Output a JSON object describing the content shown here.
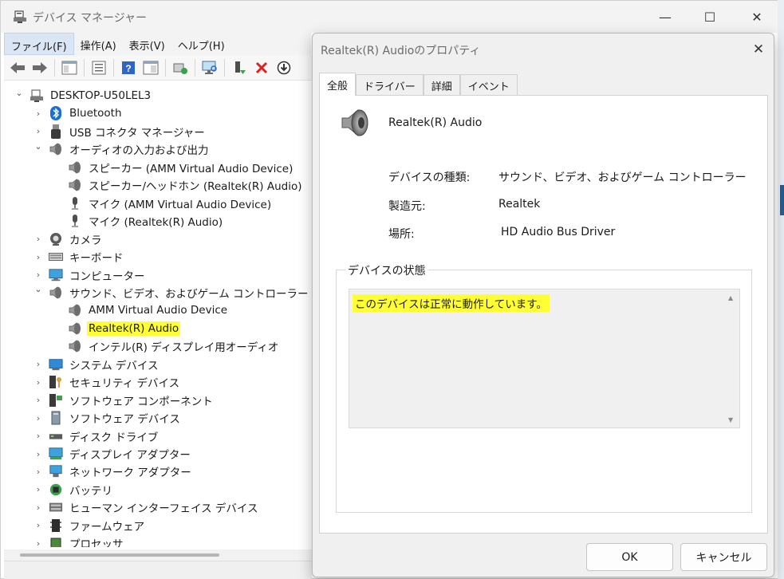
{
  "window": {
    "title": "デバイス マネージャー",
    "controls": {
      "minimize": "—",
      "maximize": "☐",
      "close": "✕"
    }
  },
  "menu": [
    "ファイル(F)",
    "操作(A)",
    "表示(V)",
    "ヘルプ(H)"
  ],
  "toolbar": [
    "back-arrow-icon",
    "forward-arrow-icon",
    "tree-view-icon",
    "properties-icon",
    "help-icon",
    "show-hidden-icon",
    "update-driver-icon",
    "scan-hardware-icon",
    "enable-device-icon",
    "uninstall-icon",
    "download-icon"
  ],
  "tree": [
    {
      "label": "DESKTOP-U50LEL3",
      "level": 0,
      "expanded": true,
      "icon": "computer-icon"
    },
    {
      "label": "Bluetooth",
      "level": 1,
      "expanded": false,
      "icon": "bluetooth-icon"
    },
    {
      "label": "USB コネクタ マネージャー",
      "level": 1,
      "expanded": false,
      "icon": "usb-icon"
    },
    {
      "label": "オーディオの入力および出力",
      "level": 1,
      "expanded": true,
      "icon": "speaker-icon"
    },
    {
      "label": "スピーカー (AMM Virtual Audio Device)",
      "level": 2,
      "icon": "speaker-icon"
    },
    {
      "label": "スピーカー/ヘッドホン (Realtek(R) Audio)",
      "level": 2,
      "icon": "speaker-icon"
    },
    {
      "label": "マイク (AMM Virtual Audio Device)",
      "level": 2,
      "icon": "microphone-icon"
    },
    {
      "label": "マイク (Realtek(R) Audio)",
      "level": 2,
      "icon": "microphone-icon"
    },
    {
      "label": "カメラ",
      "level": 1,
      "expanded": false,
      "icon": "camera-icon"
    },
    {
      "label": "キーボード",
      "level": 1,
      "expanded": false,
      "icon": "keyboard-icon"
    },
    {
      "label": "コンピューター",
      "level": 1,
      "expanded": false,
      "icon": "monitor-icon"
    },
    {
      "label": "サウンド、ビデオ、およびゲーム コントローラー",
      "level": 1,
      "expanded": true,
      "icon": "speaker-icon"
    },
    {
      "label": "AMM Virtual Audio Device",
      "level": 2,
      "icon": "speaker-icon"
    },
    {
      "label": "Realtek(R) Audio",
      "level": 2,
      "icon": "speaker-icon",
      "highlighted": true
    },
    {
      "label": "インテル(R) ディスプレイ用オーディオ",
      "level": 2,
      "icon": "speaker-icon"
    },
    {
      "label": "システム デバイス",
      "level": 1,
      "expanded": false,
      "icon": "system-folder-icon"
    },
    {
      "label": "セキュリティ デバイス",
      "level": 1,
      "expanded": false,
      "icon": "security-key-icon"
    },
    {
      "label": "ソフトウェア コンポーネント",
      "level": 1,
      "expanded": false,
      "icon": "software-component-icon"
    },
    {
      "label": "ソフトウェア デバイス",
      "level": 1,
      "expanded": false,
      "icon": "software-device-icon"
    },
    {
      "label": "ディスク ドライブ",
      "level": 1,
      "expanded": false,
      "icon": "disk-drive-icon"
    },
    {
      "label": "ディスプレイ アダプター",
      "level": 1,
      "expanded": false,
      "icon": "display-adapter-icon"
    },
    {
      "label": "ネットワーク アダプター",
      "level": 1,
      "expanded": false,
      "icon": "network-adapter-icon"
    },
    {
      "label": "バッテリ",
      "level": 1,
      "expanded": false,
      "icon": "battery-icon"
    },
    {
      "label": "ヒューマン インターフェイス デバイス",
      "level": 1,
      "expanded": false,
      "icon": "hid-icon"
    },
    {
      "label": "ファームウェア",
      "level": 1,
      "expanded": false,
      "icon": "firmware-icon"
    },
    {
      "label": "プロセッサ",
      "level": 1,
      "expanded": false,
      "icon": "processor-icon"
    }
  ],
  "dialog": {
    "title": "Realtek(R) Audioのプロパティ",
    "tabs": [
      "全般",
      "ドライバー",
      "詳細",
      "イベント"
    ],
    "active_tab": "全般",
    "device_name": "Realtek(R) Audio",
    "properties": [
      {
        "label": "デバイスの種類:",
        "value": "サウンド、ビデオ、およびゲーム コントローラー"
      },
      {
        "label": "製造元:",
        "value": "Realtek"
      },
      {
        "label": "場所:",
        "value": "HD Audio Bus Driver"
      }
    ],
    "status_group_label": "デバイスの状態",
    "status_text": "このデバイスは正常に動作しています。",
    "ok_label": "OK",
    "cancel_label": "キャンセル",
    "close_glyph": "✕"
  },
  "colors": {
    "highlight": "#ffff33",
    "accent_blue": "#1f5aa8"
  }
}
